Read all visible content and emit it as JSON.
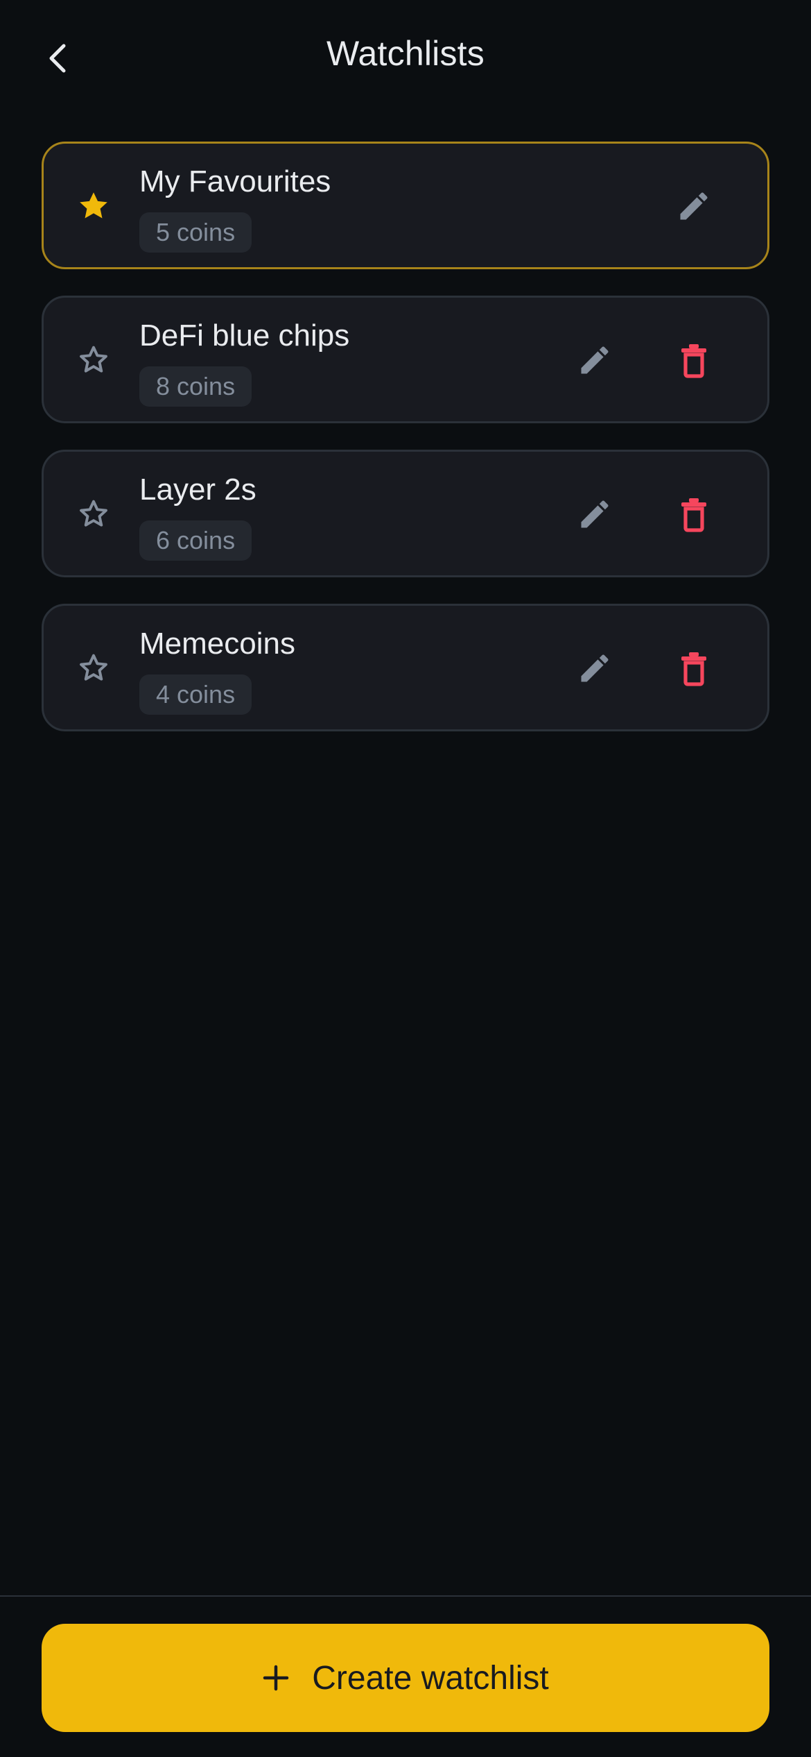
{
  "header": {
    "title": "Watchlists",
    "back_icon": "chevron-left-icon"
  },
  "colors": {
    "background": "#0b0e11",
    "card": "#181a20",
    "card_border": "#2b3139",
    "active_border": "#a7841a",
    "accent": "#f0b90b",
    "danger": "#f6465d",
    "muted": "#848e9c"
  },
  "watchlists": [
    {
      "name": "My Favourites",
      "count": "5 coins",
      "favorite": true,
      "deletable": false
    },
    {
      "name": "DeFi blue chips",
      "count": "8 coins",
      "favorite": false,
      "deletable": true
    },
    {
      "name": "Layer 2s",
      "count": "6 coins",
      "favorite": false,
      "deletable": true
    },
    {
      "name": "Memecoins",
      "count": "4 coins",
      "favorite": false,
      "deletable": true
    }
  ],
  "footer": {
    "create_label": "Create watchlist",
    "create_icon": "plus-icon"
  }
}
